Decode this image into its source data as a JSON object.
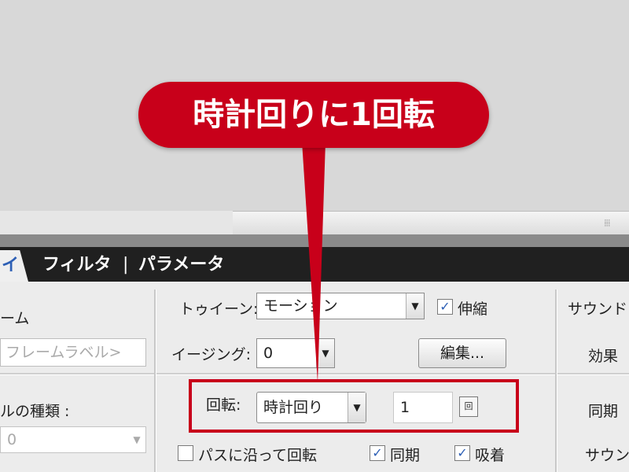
{
  "callout": {
    "text": "時計回りに1回転"
  },
  "tabs": {
    "active_label": "イ",
    "items": [
      "フィルタ",
      "|",
      "パラメータ"
    ]
  },
  "frame_section": {
    "title": "ーム",
    "label_placeholder": "フレームラベル>",
    "symbol_type_label": "ルの種類 :",
    "symbol_type_value": "0"
  },
  "tween": {
    "tween_label": "トゥイーン:",
    "tween_value": "モーション",
    "scale_label": "伸縮",
    "scale_checked": true,
    "easing_label": "イージング:",
    "easing_value": "0",
    "edit_button": "編集...",
    "rotate_label": "回転:",
    "rotate_value": "時計回り",
    "rotate_count": "1",
    "rotate_unit": "回",
    "orient_to_path_label": "パスに沿って回転",
    "orient_to_path_checked": false,
    "sync_label": "同期",
    "sync_checked": true,
    "snap_label": "吸着",
    "snap_checked": true
  },
  "sound_section": {
    "sound_label": "サウンド",
    "effect_label": "効果",
    "sync_label": "同期",
    "sound_label2": "サウン"
  },
  "colors": {
    "accent_red": "#c8001a",
    "tab_bg": "#202020"
  }
}
